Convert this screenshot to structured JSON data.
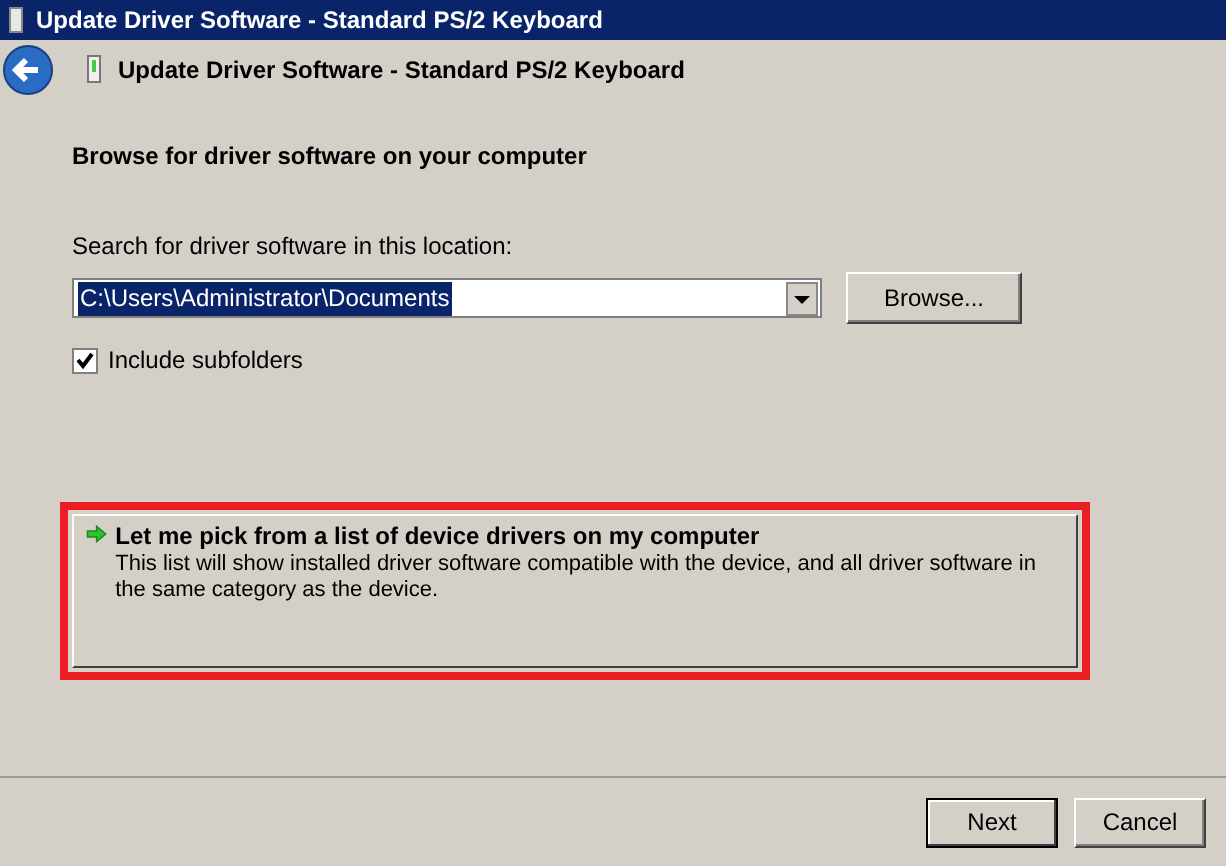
{
  "window": {
    "title": "Update Driver Software - Standard PS/2 Keyboard"
  },
  "header": {
    "title": "Update Driver Software - Standard PS/2 Keyboard"
  },
  "heading": "Browse for driver software on your computer",
  "location": {
    "label": "Search for driver software in this location:",
    "value": "C:\\Users\\Administrator\\Documents",
    "value_selected": true,
    "browse_button": "Browse..."
  },
  "include_subfolders": {
    "label": "Include subfolders",
    "checked": true
  },
  "option": {
    "title": "Let me pick from a list of device drivers on my computer",
    "description": "This list will show installed driver software compatible with the device, and all driver software in the same category as the device.",
    "highlighted": true
  },
  "buttons": [
    {
      "label": "Next",
      "default": true
    },
    {
      "label": "Cancel",
      "default": false
    }
  ]
}
